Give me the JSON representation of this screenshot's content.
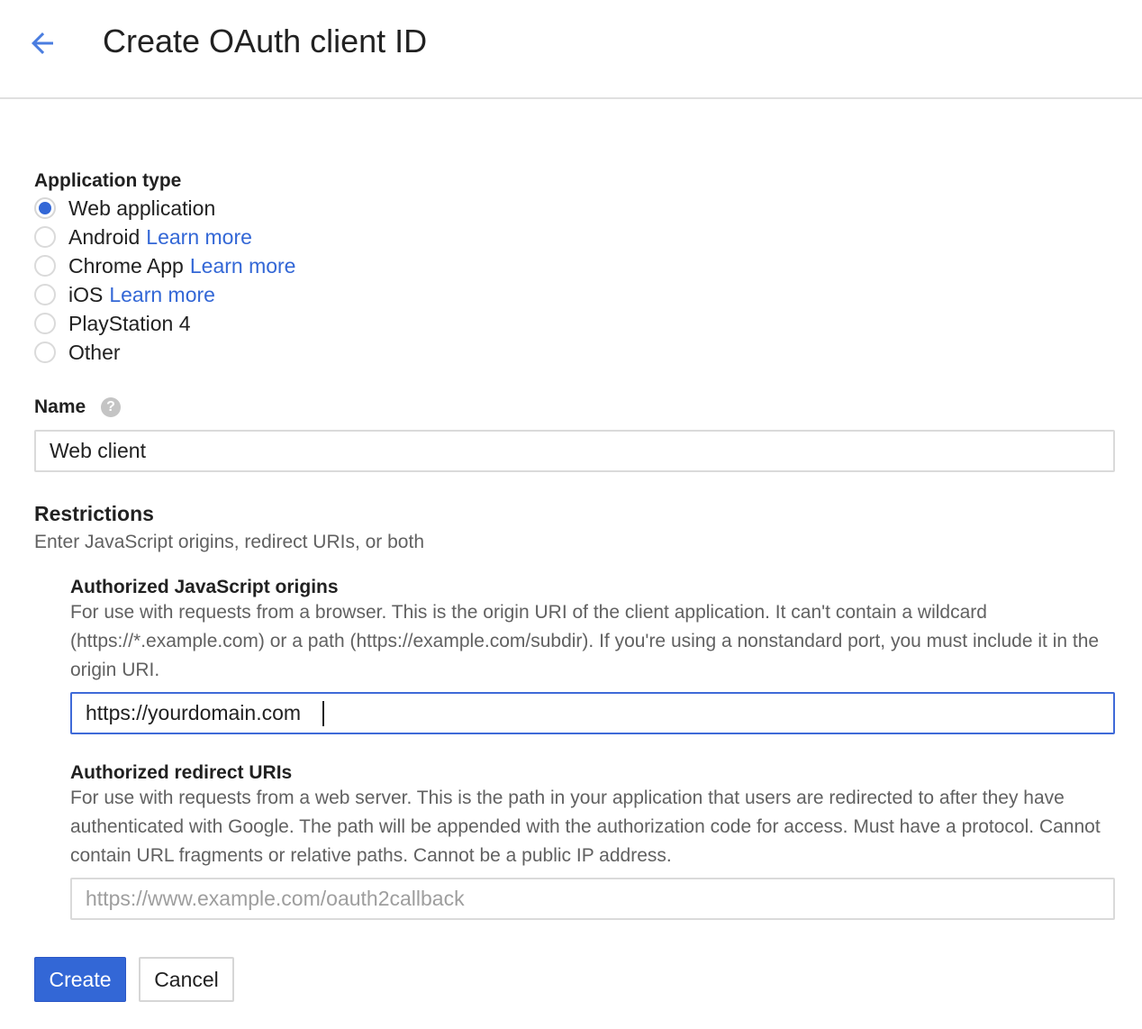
{
  "header": {
    "back_icon": "arrow-back-icon",
    "title": "Create OAuth client ID"
  },
  "colors": {
    "accent": "#3367d6",
    "link": "#3367d6",
    "border": "#dadada",
    "focus_border": "#3f6ad8"
  },
  "application_type": {
    "label": "Application type",
    "selected": "Web application",
    "options": [
      {
        "label": "Web application",
        "learn_more": ""
      },
      {
        "label": "Android",
        "learn_more": "Learn more"
      },
      {
        "label": "Chrome App",
        "learn_more": "Learn more"
      },
      {
        "label": "iOS",
        "learn_more": "Learn more"
      },
      {
        "label": "PlayStation 4",
        "learn_more": ""
      },
      {
        "label": "Other",
        "learn_more": ""
      }
    ]
  },
  "name": {
    "label": "Name",
    "help_icon": "help-icon",
    "help_glyph": "?",
    "value": "Web client"
  },
  "restrictions": {
    "title": "Restrictions",
    "subtitle": "Enter JavaScript origins, redirect URIs, or both",
    "js_origins": {
      "label": "Authorized JavaScript origins",
      "description": "For use with requests from a browser. This is the origin URI of the client application. It can't contain a wildcard (https://*.example.com) or a path (https://example.com/subdir). If you're using a nonstandard port, you must include it in the origin URI.",
      "value": "https://yourdomain.com"
    },
    "redirect_uris": {
      "label": "Authorized redirect URIs",
      "description": "For use with requests from a web server. This is the path in your application that users are redirected to after they have authenticated with Google. The path will be appended with the authorization code for access. Must have a protocol. Cannot contain URL fragments or relative paths. Cannot be a public IP address.",
      "placeholder": "https://www.example.com/oauth2callback"
    }
  },
  "actions": {
    "create_label": "Create",
    "cancel_label": "Cancel"
  }
}
